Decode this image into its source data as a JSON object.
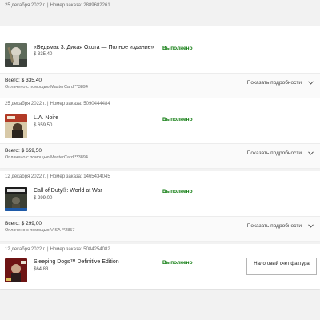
{
  "orders": [
    {
      "date": "25 декабря 2022 г.",
      "order_number": "Номер заказа: 2889682261",
      "product_name": "«Ведьмак 3: Дикая Охота — Полное издание»",
      "price": "$ 335,40",
      "status": "Выполнено",
      "total": "Всего: $ 335,40",
      "paid_with": "Оплачено с помощью MasterCard **3894",
      "details_label": "Показать подробности",
      "cover_icon": "witcher-cover-icon"
    },
    {
      "date": "25 декабря 2022 г.",
      "order_number": "Номер заказа: 5090444484",
      "product_name": "L.A. Noire",
      "price": "$ 659,50",
      "status": "Выполнено",
      "total": "Всего: $ 659,50",
      "paid_with": "Оплачено с помощью MasterCard **3894",
      "details_label": "Показать подробности",
      "cover_icon": "la-noire-cover-icon"
    },
    {
      "date": "12 декабря 2022 г.",
      "order_number": "Номер заказа: 1465434045",
      "product_name": "Call of Duty®: World at War",
      "price": "$ 299,00",
      "status": "Выполнено",
      "total": "Всего: $ 299,00",
      "paid_with": "Оплачено с помощью VISA **2857",
      "details_label": "Показать подробности",
      "cover_icon": "call-of-duty-cover-icon"
    },
    {
      "date": "12 декабря 2022 г.",
      "order_number": "Номер заказа: 5084254082",
      "product_name": "Sleeping Dogs™ Definitive Edition",
      "price": "$64.83",
      "status": "Выполнено",
      "invoice_label": "Налоговый счет фактура",
      "cover_icon": "sleeping-dogs-cover-icon"
    }
  ],
  "colors": {
    "status_green": "#107c10",
    "background": "#f2f2f2",
    "card": "#ffffff"
  }
}
